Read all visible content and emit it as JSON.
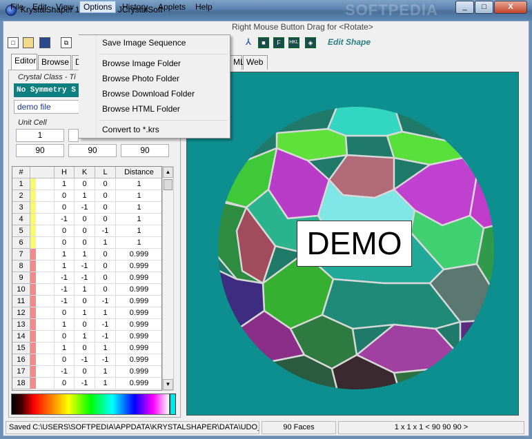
{
  "window": {
    "title": "KrystalShaper 1.1   © 2010 JCrystalSoft",
    "watermark": "SOFTPEDIA",
    "controls": [
      "_",
      "□",
      "X"
    ]
  },
  "menubar": {
    "items": [
      "File",
      "Edit",
      "View",
      "Options",
      "History",
      "Applets",
      "Help"
    ],
    "active": "Options",
    "hint": "Right Mouse Button Drag for <Rotate>"
  },
  "toolbar": {
    "icons": [
      "new-icon",
      "open-icon",
      "save-icon",
      "copy-icon"
    ],
    "right_icons": [
      "axes-icon",
      "cube-icon",
      "face-icon",
      "hkl-icon",
      "shape-icon"
    ],
    "right_icon_text": [
      "",
      "",
      "F",
      "HKL",
      ""
    ],
    "edit_shape_label": "Edit Shape"
  },
  "tabs": {
    "left": [
      "Editor",
      "Browse",
      "D"
    ],
    "right": [
      "ML",
      "Web"
    ],
    "selected": "Editor"
  },
  "crystal_class": {
    "label": "Crystal Class - Ti",
    "value": "No Symmetry S",
    "file": "demo file"
  },
  "unit_cell": {
    "label": "Unit Cell",
    "a": "1",
    "alpha": "90",
    "beta": "90",
    "gamma": "90"
  },
  "grid": {
    "headers": [
      "#",
      "H",
      "K",
      "L",
      "Distance"
    ],
    "rows": [
      {
        "n": "1",
        "h": "1",
        "k": "0",
        "l": "0",
        "d": "1",
        "color": "#f8f878"
      },
      {
        "n": "2",
        "h": "0",
        "k": "1",
        "l": "0",
        "d": "1",
        "color": "#f8f878"
      },
      {
        "n": "3",
        "h": "0",
        "k": "-1",
        "l": "0",
        "d": "1",
        "color": "#f8f878"
      },
      {
        "n": "4",
        "h": "-1",
        "k": "0",
        "l": "0",
        "d": "1",
        "color": "#f8f878"
      },
      {
        "n": "5",
        "h": "0",
        "k": "0",
        "l": "-1",
        "d": "1",
        "color": "#f8f878"
      },
      {
        "n": "6",
        "h": "0",
        "k": "0",
        "l": "1",
        "d": "1",
        "color": "#f8f878"
      },
      {
        "n": "7",
        "h": "1",
        "k": "1",
        "l": "0",
        "d": "0.999",
        "color": "#f08c8c"
      },
      {
        "n": "8",
        "h": "1",
        "k": "-1",
        "l": "0",
        "d": "0.999",
        "color": "#f08c8c"
      },
      {
        "n": "9",
        "h": "-1",
        "k": "-1",
        "l": "0",
        "d": "0.999",
        "color": "#f08c8c"
      },
      {
        "n": "10",
        "h": "-1",
        "k": "1",
        "l": "0",
        "d": "0.999",
        "color": "#f08c8c"
      },
      {
        "n": "11",
        "h": "-1",
        "k": "0",
        "l": "-1",
        "d": "0.999",
        "color": "#f08c8c"
      },
      {
        "n": "12",
        "h": "0",
        "k": "1",
        "l": "1",
        "d": "0.999",
        "color": "#f08c8c"
      },
      {
        "n": "13",
        "h": "1",
        "k": "0",
        "l": "-1",
        "d": "0.999",
        "color": "#f08c8c"
      },
      {
        "n": "14",
        "h": "0",
        "k": "1",
        "l": "-1",
        "d": "0.999",
        "color": "#f08c8c"
      },
      {
        "n": "15",
        "h": "1",
        "k": "0",
        "l": "1",
        "d": "0.999",
        "color": "#f08c8c"
      },
      {
        "n": "16",
        "h": "0",
        "k": "-1",
        "l": "-1",
        "d": "0.999",
        "color": "#f08c8c"
      },
      {
        "n": "17",
        "h": "-1",
        "k": "0",
        "l": "1",
        "d": "0.999",
        "color": "#f08c8c"
      },
      {
        "n": "18",
        "h": "0",
        "k": "-1",
        "l": "1",
        "d": "0.999",
        "color": "#f08c8c"
      }
    ]
  },
  "viewport": {
    "overlay_text": "DEMO",
    "background": "#0e8f8f"
  },
  "options_menu": {
    "items": [
      "Save Image Sequence",
      "Browse Image Folder",
      "Browse Photo Folder",
      "Browse Download Folder",
      "Browse HTML Folder",
      "Convert to *.krs"
    ]
  },
  "status": {
    "path": "Saved C:\\USERS\\SOFTPEDIA\\APPDATA\\KRYSTALSHAPER\\DATA\\UDO_BE",
    "faces": "90 Faces",
    "cell": "1 x 1 x 1 < 90 90 90 >"
  }
}
